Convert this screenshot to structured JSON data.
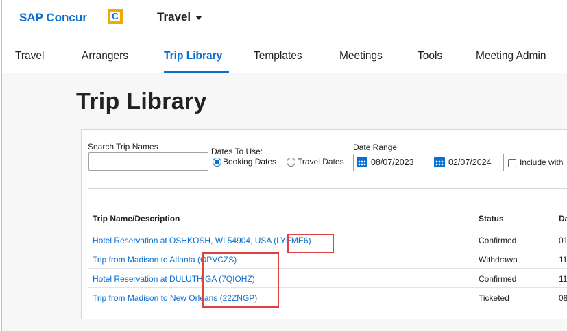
{
  "header": {
    "brand": "SAP Concur",
    "brand_logo_glyph": "C",
    "module": "Travel"
  },
  "nav": {
    "items": [
      {
        "label": "Travel",
        "active": false
      },
      {
        "label": "Arrangers",
        "active": false
      },
      {
        "label": "Trip Library",
        "active": true
      },
      {
        "label": "Templates",
        "active": false
      },
      {
        "label": "Meetings",
        "active": false
      },
      {
        "label": "Tools",
        "active": false
      },
      {
        "label": "Meeting Admin",
        "active": false
      }
    ]
  },
  "page": {
    "title": "Trip Library"
  },
  "filters": {
    "search_label": "Search Trip Names",
    "search_value": "",
    "dates_to_use_label": "Dates To Use:",
    "booking_dates_label": "Booking Dates",
    "travel_dates_label": "Travel Dates",
    "selected_dates_option": "Booking Dates",
    "date_range_label": "Date Range",
    "start_date": "08/07/2023",
    "end_date": "02/07/2024",
    "include_label": "Include with",
    "include_checked": false
  },
  "table": {
    "columns": [
      "Trip Name/Description",
      "Status",
      "Da"
    ],
    "rows": [
      {
        "name": "Hotel Reservation at OSHKOSH, WI 54904, USA (LYEME6)",
        "status": "Confirmed",
        "date": "01"
      },
      {
        "name": "Trip from Madison to Atlanta (OPVCZS)",
        "status": "Withdrawn",
        "date": "11"
      },
      {
        "name": "Hotel Reservation at DULUTH GA (7QIOHZ)",
        "status": "Confirmed",
        "date": "11"
      },
      {
        "name": "Trip from Madison to New Orleans (22ZNGP)",
        "status": "Ticketed",
        "date": "08"
      }
    ]
  },
  "colors": {
    "accent": "#0a6ed1",
    "highlight_box": "#e0403f",
    "logo": "#f0ab00"
  }
}
